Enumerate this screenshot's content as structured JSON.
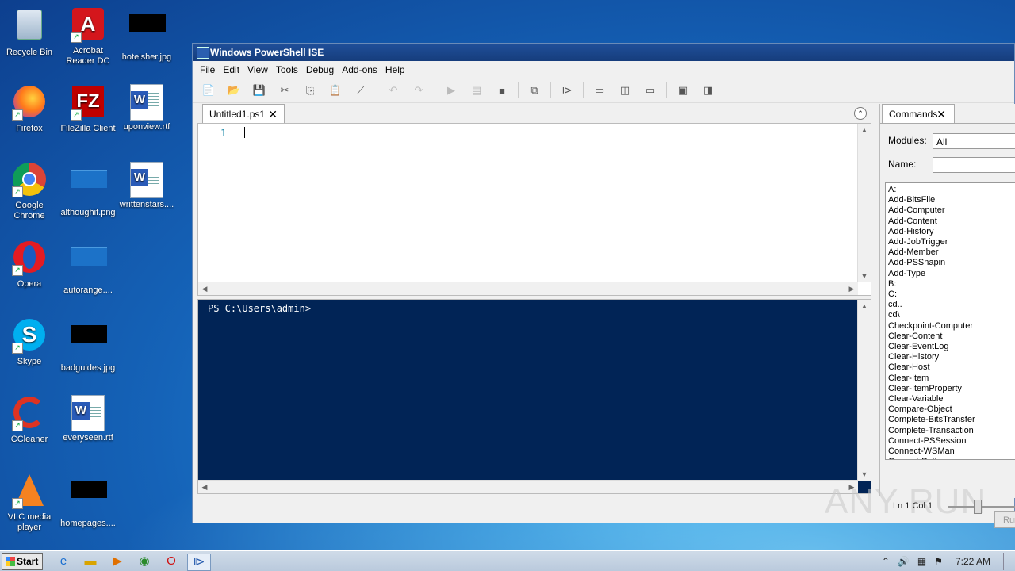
{
  "desktop": {
    "icons": [
      {
        "label": "Recycle Bin",
        "icon": "recycle-bin-icon"
      },
      {
        "label": "Acrobat Reader DC",
        "icon": "acrobat-icon"
      },
      {
        "label": "hotelsher.jpg",
        "icon": "image-file-icon"
      },
      {
        "label": "Firefox",
        "icon": "firefox-icon"
      },
      {
        "label": "FileZilla Client",
        "icon": "filezilla-icon"
      },
      {
        "label": "uponview.rtf",
        "icon": "word-doc-icon"
      },
      {
        "label": "Google Chrome",
        "icon": "chrome-icon"
      },
      {
        "label": "althoughif.png",
        "icon": "image-file-icon"
      },
      {
        "label": "writtenstars....",
        "icon": "word-doc-icon"
      },
      {
        "label": "Opera",
        "icon": "opera-icon"
      },
      {
        "label": "autorange....",
        "icon": "image-file-icon"
      },
      {
        "label": "Skype",
        "icon": "skype-icon"
      },
      {
        "label": "badguides.jpg",
        "icon": "image-file-icon"
      },
      {
        "label": "CCleaner",
        "icon": "ccleaner-icon"
      },
      {
        "label": "everyseen.rtf",
        "icon": "word-doc-icon"
      },
      {
        "label": "VLC media player",
        "icon": "vlc-icon"
      },
      {
        "label": "homepages....",
        "icon": "image-file-icon"
      }
    ]
  },
  "window": {
    "title": "Windows PowerShell ISE",
    "menu": [
      "File",
      "Edit",
      "View",
      "Tools",
      "Debug",
      "Add-ons",
      "Help"
    ],
    "tab": "Untitled1.ps1",
    "line_number": "1",
    "console_prompt": "PS C:\\Users\\admin>",
    "commands": {
      "tab": "Commands",
      "modules_label": "Modules:",
      "modules_value": "All",
      "name_label": "Name:",
      "name_value": "",
      "list": [
        "A:",
        "Add-BitsFile",
        "Add-Computer",
        "Add-Content",
        "Add-History",
        "Add-JobTrigger",
        "Add-Member",
        "Add-PSSnapin",
        "Add-Type",
        "B:",
        "C:",
        "cd..",
        "cd\\",
        "Checkpoint-Computer",
        "Clear-Content",
        "Clear-EventLog",
        "Clear-History",
        "Clear-Host",
        "Clear-Item",
        "Clear-ItemProperty",
        "Clear-Variable",
        "Compare-Object",
        "Complete-BitsTransfer",
        "Complete-Transaction",
        "Connect-PSSession",
        "Connect-WSMan",
        "Convert-Path"
      ],
      "run_label": "Run"
    },
    "status": "Ln 1  Col 1"
  },
  "watermark": "ANY RUN",
  "taskbar": {
    "start_label": "Start",
    "clock": "7:22 AM"
  }
}
